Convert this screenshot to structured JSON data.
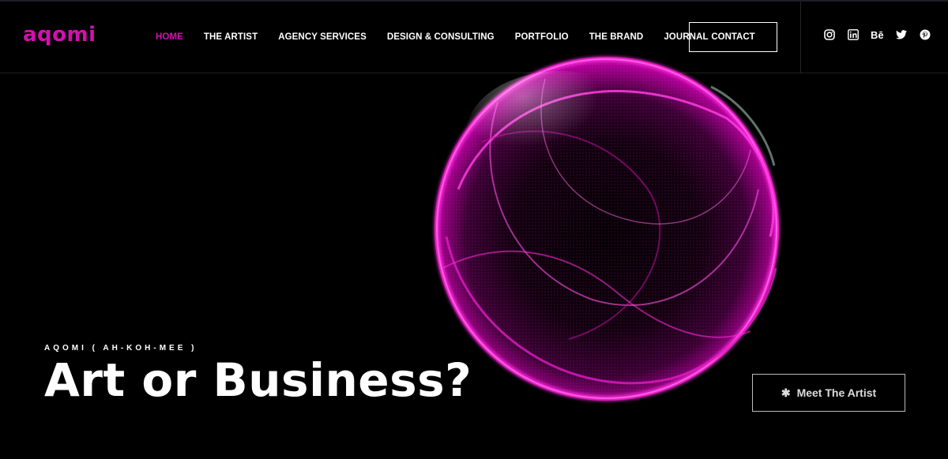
{
  "brand": {
    "logo": "aqomi",
    "accent": "#d40fb2"
  },
  "nav": {
    "items": [
      {
        "label": "HOME",
        "active": true
      },
      {
        "label": "THE ARTIST"
      },
      {
        "label": "AGENCY SERVICES"
      },
      {
        "label": "DESIGN & CONSULTING"
      },
      {
        "label": "PORTFOLIO"
      },
      {
        "label": "THE BRAND"
      },
      {
        "label": "JOURNAL"
      }
    ],
    "contact_label": "CONTACT"
  },
  "social": {
    "icons": [
      "instagram-icon",
      "linkedin-icon",
      "behance-icon",
      "twitter-icon",
      "pinterest-icon"
    ],
    "behance_text": "Bē"
  },
  "hero": {
    "subtitle": "AQOMI ( AH-KOH-MEE )",
    "title": "Art or Business?",
    "cta_icon": "✱",
    "cta_label": "Meet The Artist"
  }
}
